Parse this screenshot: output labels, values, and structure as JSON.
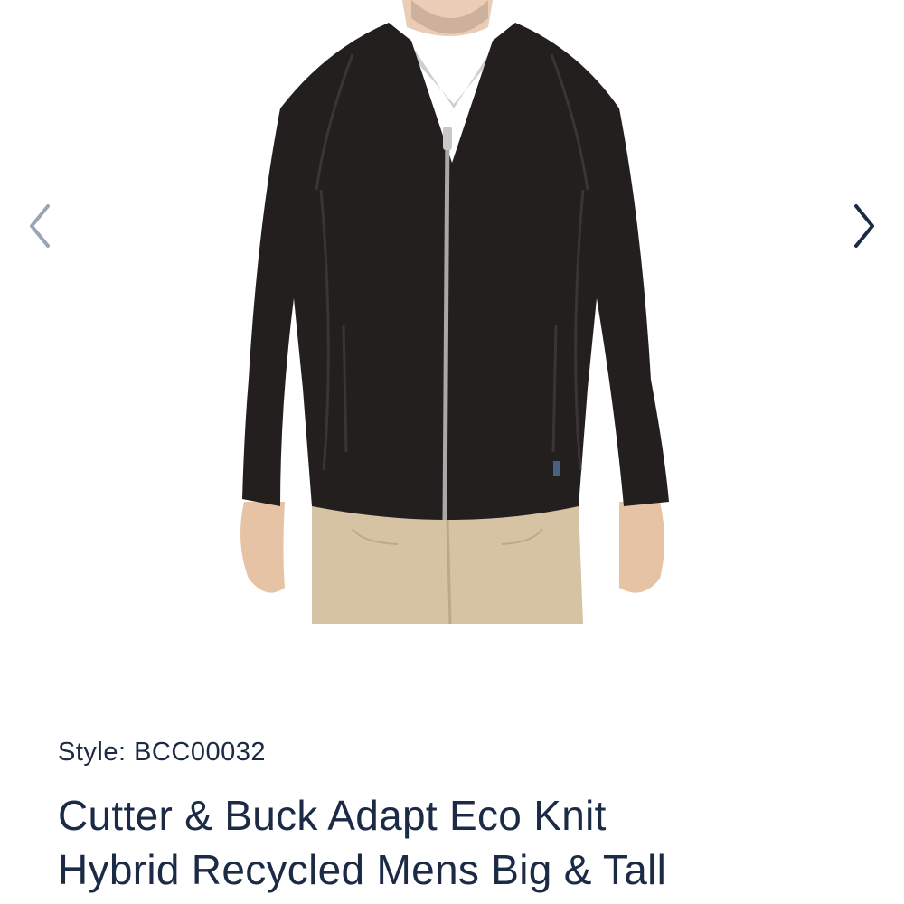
{
  "carousel": {
    "prev_icon": "chevron-left-icon",
    "next_icon": "chevron-right-icon",
    "prev_color": "#9aa6b4",
    "next_color": "#1b2a45",
    "image_alt": "Cutter & Buck Adapt Eco Knit Hybrid Recycled Mens Big & Tall"
  },
  "product": {
    "style_label": "Style:",
    "style_code": "BCC00032",
    "title_line1": "Cutter & Buck Adapt Eco Knit",
    "title_line2": "Hybrid Recycled Mens Big & Tall",
    "text_color": "#1b2a45"
  }
}
